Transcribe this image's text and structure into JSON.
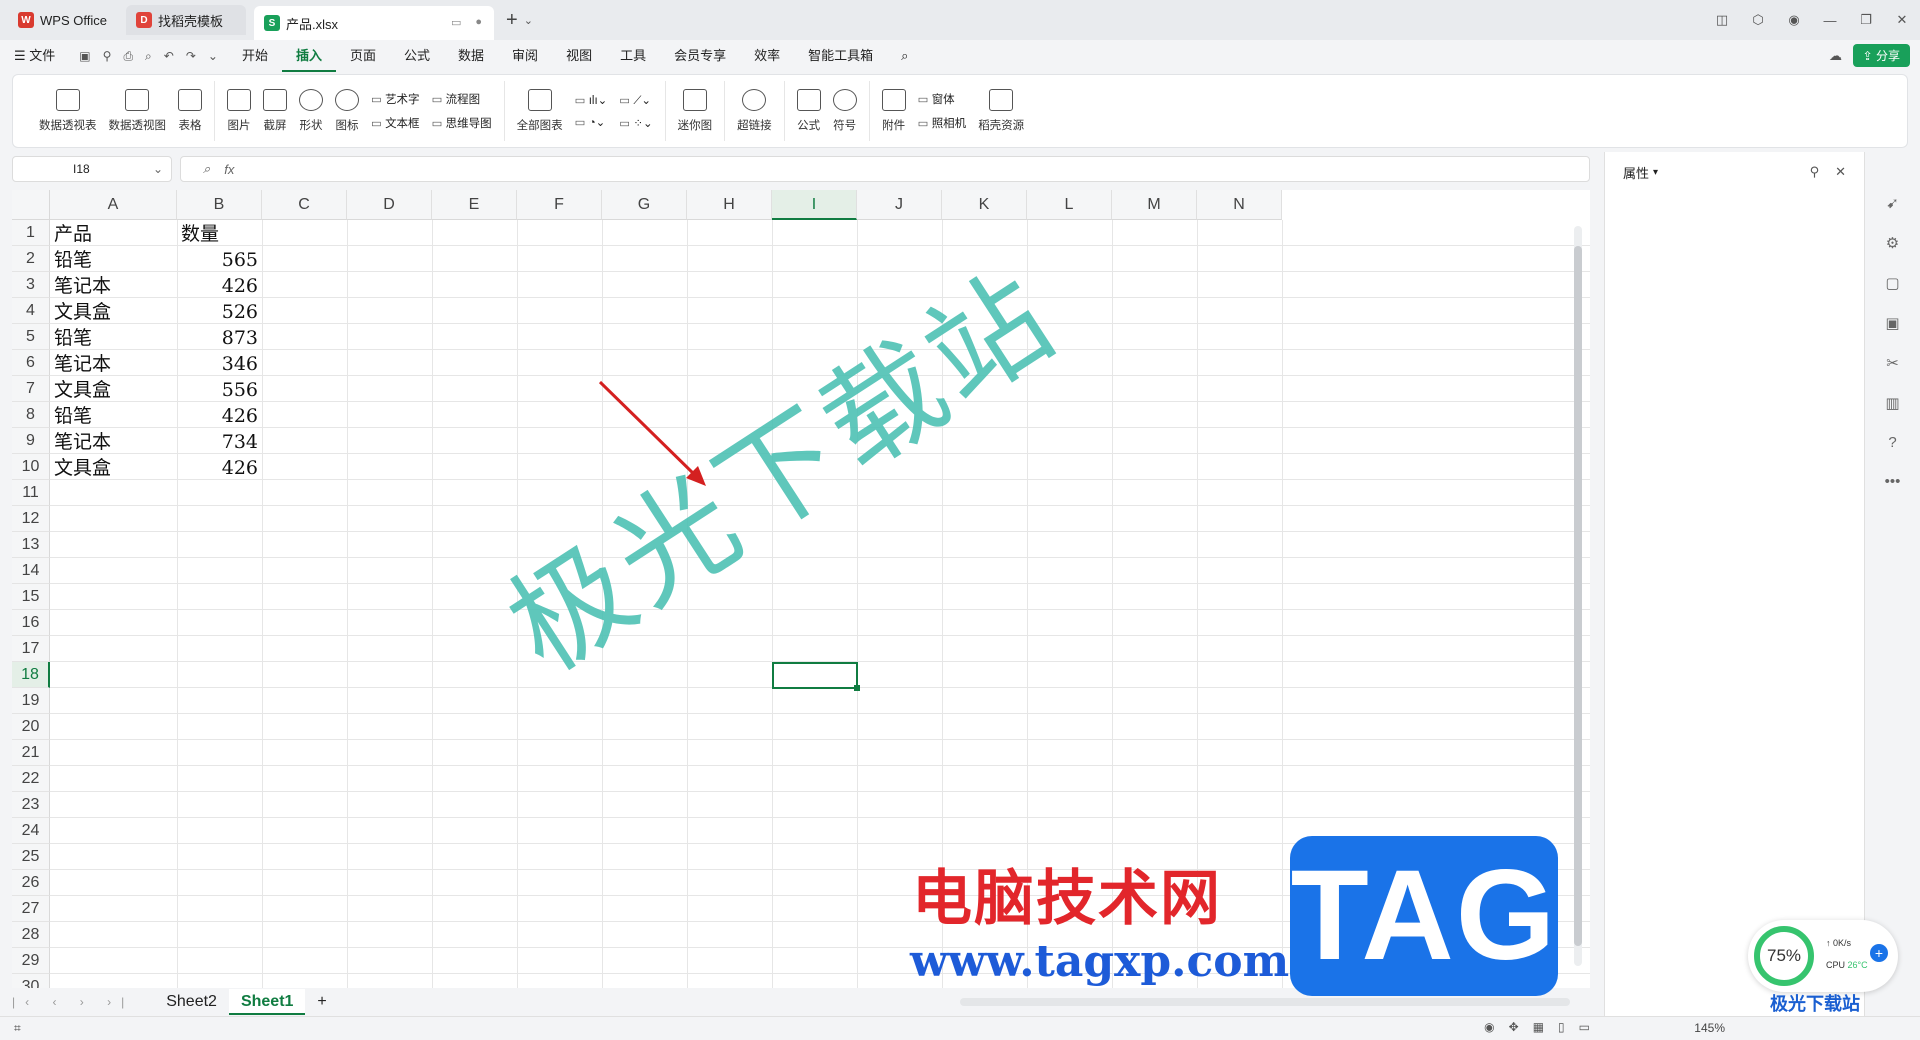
{
  "tabs": {
    "wps": "WPS Office",
    "template": "找稻壳模板",
    "file": "产品.xlsx"
  },
  "menu": {
    "file": "文件",
    "items": [
      "开始",
      "插入",
      "页面",
      "公式",
      "数据",
      "审阅",
      "视图",
      "工具",
      "会员专享",
      "效率",
      "智能工具箱"
    ],
    "active": "插入",
    "share": "分享"
  },
  "ribbon": {
    "pivot_table": "数据透视表",
    "pivot_chart": "数据透视图",
    "table": "表格",
    "picture": "图片",
    "screenshot": "截屏",
    "shape": "形状",
    "icon": "图标",
    "wordart": "艺术字",
    "textbox": "文本框",
    "flowchart": "流程图",
    "mindmap": "思维导图",
    "all_charts": "全部图表",
    "sparkline": "迷你图",
    "hyperlink": "超链接",
    "formula": "公式",
    "symbol": "符号",
    "attachment": "附件",
    "form": "窗体",
    "camera": "照相机",
    "shell_resources": "稻壳资源"
  },
  "formula_bar": {
    "cell_ref": "I18",
    "fx": "fx",
    "value": ""
  },
  "grid": {
    "columns": [
      "A",
      "B",
      "C",
      "D",
      "E",
      "F",
      "G",
      "H",
      "I",
      "J",
      "K",
      "L",
      "M",
      "N"
    ],
    "selected_column": "I",
    "rows": [
      "1",
      "2",
      "3",
      "4",
      "5",
      "6",
      "7",
      "8",
      "9",
      "10",
      "11",
      "12",
      "13",
      "14",
      "15",
      "16",
      "17",
      "18",
      "19",
      "20",
      "21",
      "22",
      "23",
      "24",
      "25",
      "26",
      "27",
      "28",
      "29",
      "30"
    ],
    "selected_row": "18",
    "data": [
      [
        "产品",
        "数量"
      ],
      [
        "铅笔",
        "565"
      ],
      [
        "笔记本",
        "426"
      ],
      [
        "文具盒",
        "526"
      ],
      [
        "铅笔",
        "873"
      ],
      [
        "笔记本",
        "346"
      ],
      [
        "文具盒",
        "556"
      ],
      [
        "铅笔",
        "426"
      ],
      [
        "笔记本",
        "734"
      ],
      [
        "文具盒",
        "426"
      ]
    ]
  },
  "watermark": "极光下载站",
  "sheets": [
    "Sheet2",
    "Sheet1"
  ],
  "active_sheet": "Sheet1",
  "status": {
    "zoom": "145%"
  },
  "panel": {
    "title": "属性"
  },
  "overlay": {
    "brand": "电脑技术网",
    "url": "www.tagxp.com",
    "tag": "TAG",
    "cpu_percent": "75%",
    "net": "0K/s",
    "cpu_label": "CPU",
    "cpu_temp": "26°C",
    "site_logo": "极光下载站"
  },
  "colors": {
    "accent": "#107c41",
    "watermark": "#4ec1b4",
    "brand_red": "#e2262b",
    "tag_blue": "#1a73e8"
  }
}
